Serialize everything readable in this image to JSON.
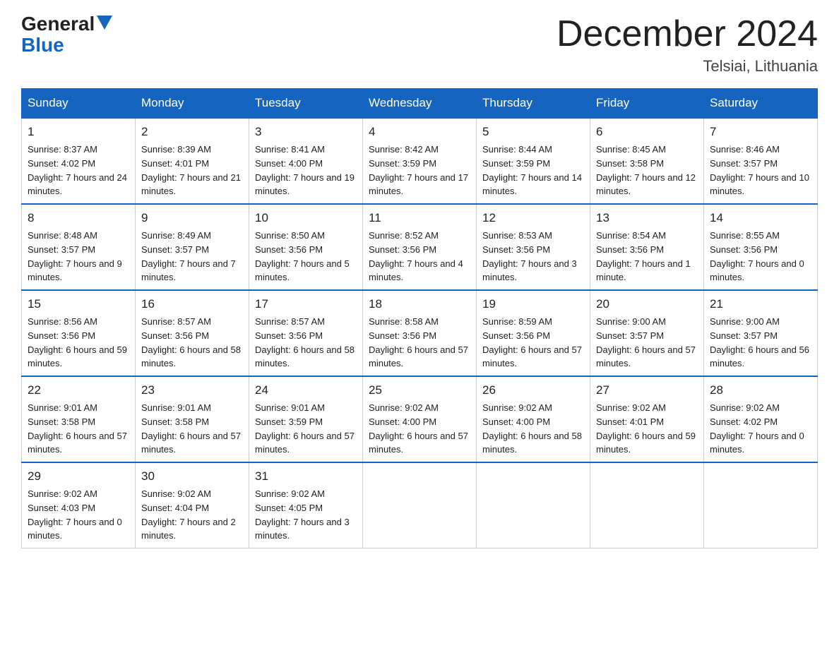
{
  "logo": {
    "line1": "General",
    "line2": "Blue"
  },
  "title": {
    "month": "December 2024",
    "location": "Telsiai, Lithuania"
  },
  "weekdays": [
    "Sunday",
    "Monday",
    "Tuesday",
    "Wednesday",
    "Thursday",
    "Friday",
    "Saturday"
  ],
  "weeks": [
    [
      {
        "day": "1",
        "sunrise": "8:37 AM",
        "sunset": "4:02 PM",
        "daylight": "7 hours and 24 minutes."
      },
      {
        "day": "2",
        "sunrise": "8:39 AM",
        "sunset": "4:01 PM",
        "daylight": "7 hours and 21 minutes."
      },
      {
        "day": "3",
        "sunrise": "8:41 AM",
        "sunset": "4:00 PM",
        "daylight": "7 hours and 19 minutes."
      },
      {
        "day": "4",
        "sunrise": "8:42 AM",
        "sunset": "3:59 PM",
        "daylight": "7 hours and 17 minutes."
      },
      {
        "day": "5",
        "sunrise": "8:44 AM",
        "sunset": "3:59 PM",
        "daylight": "7 hours and 14 minutes."
      },
      {
        "day": "6",
        "sunrise": "8:45 AM",
        "sunset": "3:58 PM",
        "daylight": "7 hours and 12 minutes."
      },
      {
        "day": "7",
        "sunrise": "8:46 AM",
        "sunset": "3:57 PM",
        "daylight": "7 hours and 10 minutes."
      }
    ],
    [
      {
        "day": "8",
        "sunrise": "8:48 AM",
        "sunset": "3:57 PM",
        "daylight": "7 hours and 9 minutes."
      },
      {
        "day": "9",
        "sunrise": "8:49 AM",
        "sunset": "3:57 PM",
        "daylight": "7 hours and 7 minutes."
      },
      {
        "day": "10",
        "sunrise": "8:50 AM",
        "sunset": "3:56 PM",
        "daylight": "7 hours and 5 minutes."
      },
      {
        "day": "11",
        "sunrise": "8:52 AM",
        "sunset": "3:56 PM",
        "daylight": "7 hours and 4 minutes."
      },
      {
        "day": "12",
        "sunrise": "8:53 AM",
        "sunset": "3:56 PM",
        "daylight": "7 hours and 3 minutes."
      },
      {
        "day": "13",
        "sunrise": "8:54 AM",
        "sunset": "3:56 PM",
        "daylight": "7 hours and 1 minute."
      },
      {
        "day": "14",
        "sunrise": "8:55 AM",
        "sunset": "3:56 PM",
        "daylight": "7 hours and 0 minutes."
      }
    ],
    [
      {
        "day": "15",
        "sunrise": "8:56 AM",
        "sunset": "3:56 PM",
        "daylight": "6 hours and 59 minutes."
      },
      {
        "day": "16",
        "sunrise": "8:57 AM",
        "sunset": "3:56 PM",
        "daylight": "6 hours and 58 minutes."
      },
      {
        "day": "17",
        "sunrise": "8:57 AM",
        "sunset": "3:56 PM",
        "daylight": "6 hours and 58 minutes."
      },
      {
        "day": "18",
        "sunrise": "8:58 AM",
        "sunset": "3:56 PM",
        "daylight": "6 hours and 57 minutes."
      },
      {
        "day": "19",
        "sunrise": "8:59 AM",
        "sunset": "3:56 PM",
        "daylight": "6 hours and 57 minutes."
      },
      {
        "day": "20",
        "sunrise": "9:00 AM",
        "sunset": "3:57 PM",
        "daylight": "6 hours and 57 minutes."
      },
      {
        "day": "21",
        "sunrise": "9:00 AM",
        "sunset": "3:57 PM",
        "daylight": "6 hours and 56 minutes."
      }
    ],
    [
      {
        "day": "22",
        "sunrise": "9:01 AM",
        "sunset": "3:58 PM",
        "daylight": "6 hours and 57 minutes."
      },
      {
        "day": "23",
        "sunrise": "9:01 AM",
        "sunset": "3:58 PM",
        "daylight": "6 hours and 57 minutes."
      },
      {
        "day": "24",
        "sunrise": "9:01 AM",
        "sunset": "3:59 PM",
        "daylight": "6 hours and 57 minutes."
      },
      {
        "day": "25",
        "sunrise": "9:02 AM",
        "sunset": "4:00 PM",
        "daylight": "6 hours and 57 minutes."
      },
      {
        "day": "26",
        "sunrise": "9:02 AM",
        "sunset": "4:00 PM",
        "daylight": "6 hours and 58 minutes."
      },
      {
        "day": "27",
        "sunrise": "9:02 AM",
        "sunset": "4:01 PM",
        "daylight": "6 hours and 59 minutes."
      },
      {
        "day": "28",
        "sunrise": "9:02 AM",
        "sunset": "4:02 PM",
        "daylight": "7 hours and 0 minutes."
      }
    ],
    [
      {
        "day": "29",
        "sunrise": "9:02 AM",
        "sunset": "4:03 PM",
        "daylight": "7 hours and 0 minutes."
      },
      {
        "day": "30",
        "sunrise": "9:02 AM",
        "sunset": "4:04 PM",
        "daylight": "7 hours and 2 minutes."
      },
      {
        "day": "31",
        "sunrise": "9:02 AM",
        "sunset": "4:05 PM",
        "daylight": "7 hours and 3 minutes."
      },
      null,
      null,
      null,
      null
    ]
  ]
}
